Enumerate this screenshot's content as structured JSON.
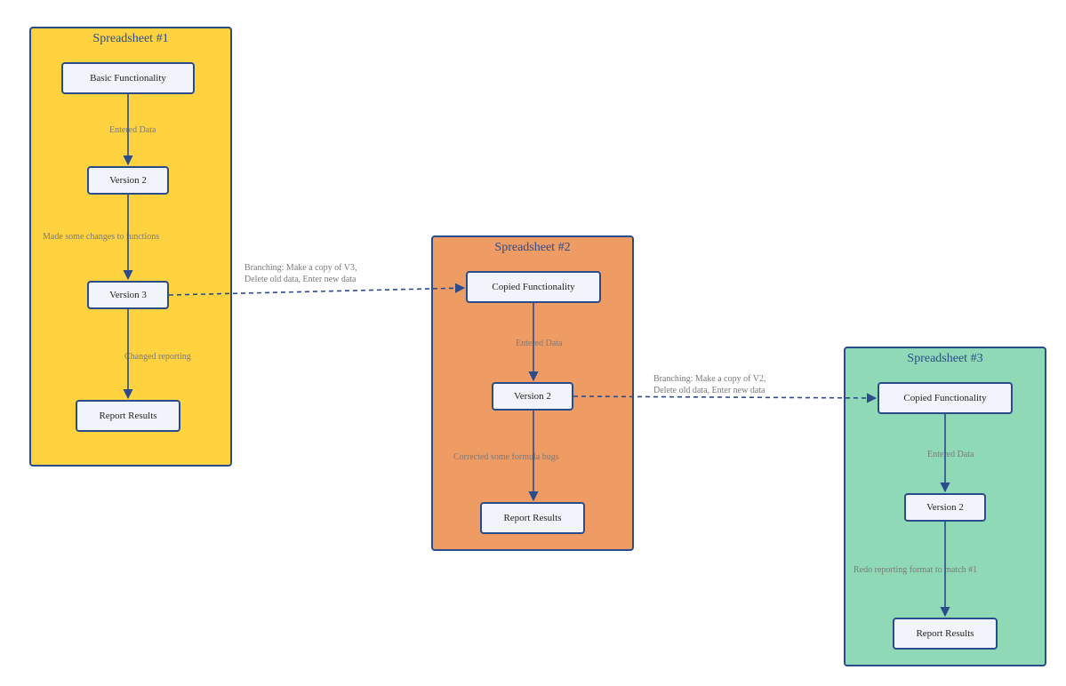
{
  "spreadsheets": [
    {
      "id": "s1",
      "title": "Spreadsheet #1",
      "color": "#ffd23f",
      "nodes": [
        {
          "id": "s1n1",
          "label": "Basic Functionality"
        },
        {
          "id": "s1n2",
          "label": "Version 2"
        },
        {
          "id": "s1n3",
          "label": "Version 3"
        },
        {
          "id": "s1n4",
          "label": "Report Results"
        }
      ],
      "edges": [
        {
          "from": "s1n1",
          "to": "s1n2",
          "label": "Entered Data"
        },
        {
          "from": "s1n2",
          "to": "s1n3",
          "label": "Made some changes to functions"
        },
        {
          "from": "s1n3",
          "to": "s1n4",
          "label": "Changed reporting"
        }
      ]
    },
    {
      "id": "s2",
      "title": "Spreadsheet #2",
      "color": "#ee9b64",
      "nodes": [
        {
          "id": "s2n1",
          "label": "Copied Functionality"
        },
        {
          "id": "s2n2",
          "label": "Version 2"
        },
        {
          "id": "s2n3",
          "label": "Report Results"
        }
      ],
      "edges": [
        {
          "from": "s2n1",
          "to": "s2n2",
          "label": "Entered Data"
        },
        {
          "from": "s2n2",
          "to": "s2n3",
          "label": "Corrected some formula bugs"
        }
      ]
    },
    {
      "id": "s3",
      "title": "Spreadsheet #3",
      "color": "#8fd9b6",
      "nodes": [
        {
          "id": "s3n1",
          "label": "Copied Functionality"
        },
        {
          "id": "s3n2",
          "label": "Version 2"
        },
        {
          "id": "s3n3",
          "label": "Report Results"
        }
      ],
      "edges": [
        {
          "from": "s3n1",
          "to": "s3n2",
          "label": "Entered Data"
        },
        {
          "from": "s3n2",
          "to": "s3n3",
          "label": "Redo reporting format to match #1"
        }
      ]
    }
  ],
  "branches": [
    {
      "from": "s1n3",
      "to": "s2n1",
      "label": "Branching: Make a copy of V3,\nDelete old data, Enter new data"
    },
    {
      "from": "s2n2",
      "to": "s3n1",
      "label": "Branching: Make a copy of V2,\nDelete old data, Enter new data"
    }
  ],
  "colors": {
    "border": "#2b4c8c",
    "nodeFill": "#f2f4fb",
    "labelGrey": "#7a7a7a"
  }
}
